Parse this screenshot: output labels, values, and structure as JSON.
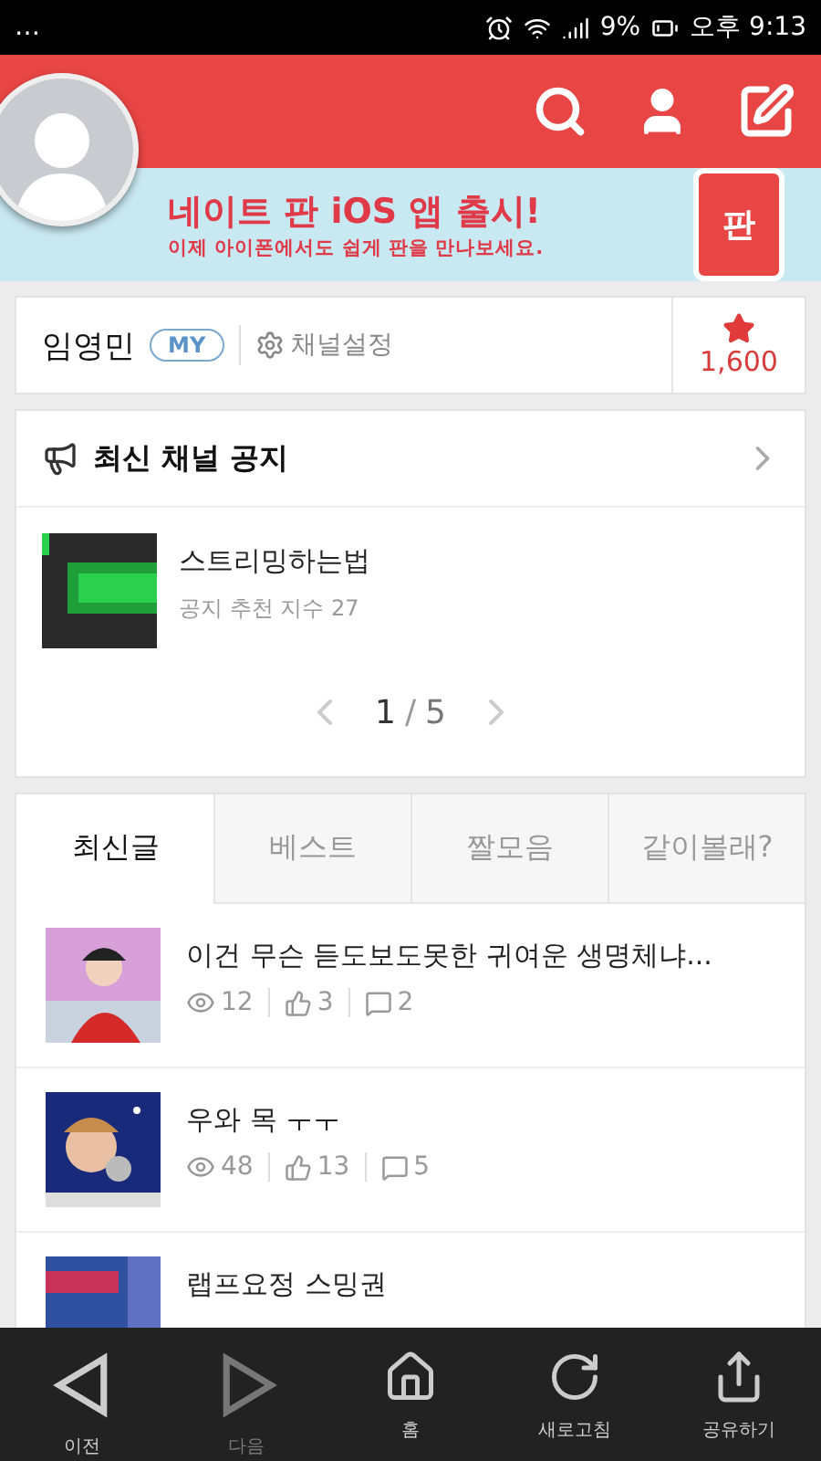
{
  "status_bar": {
    "overflow": "…",
    "battery": "9%",
    "time": "오후 9:13"
  },
  "banner": {
    "title": "네이트 판 iOS 앱 출시!",
    "subtitle": "이제 아이폰에서도 쉽게 판을 만나보세요.",
    "badge": "판"
  },
  "channel": {
    "name": "임영민",
    "tag": "MY",
    "settings": "채널설정",
    "stars": "1,600"
  },
  "notice": {
    "title": "최신 채널 공지",
    "post": {
      "title": "스트리밍하는법",
      "meta": "공지 추천 지수 27"
    },
    "page": "1",
    "separator": "/",
    "total": "5"
  },
  "tabs": [
    {
      "label": "최신글",
      "selected": true
    },
    {
      "label": "베스트",
      "selected": false
    },
    {
      "label": "짤모음",
      "selected": false
    },
    {
      "label": "같이볼래?",
      "selected": false
    }
  ],
  "posts": [
    {
      "title": "이건 무슨 듣도보도못한 귀여운 생명체냐...",
      "views": "12",
      "likes": "3",
      "comments": "2"
    },
    {
      "title": "우와 목 ㅜㅜ",
      "views": "48",
      "likes": "13",
      "comments": "5"
    },
    {
      "title": "랩프요정 스밍권"
    }
  ],
  "nav": [
    {
      "label": "이전",
      "kind": "back",
      "disabled": false
    },
    {
      "label": "다음",
      "kind": "forward",
      "disabled": true
    },
    {
      "label": "홈",
      "kind": "home",
      "disabled": false
    },
    {
      "label": "새로고침",
      "kind": "refresh",
      "disabled": false
    },
    {
      "label": "공유하기",
      "kind": "share",
      "disabled": false
    }
  ]
}
